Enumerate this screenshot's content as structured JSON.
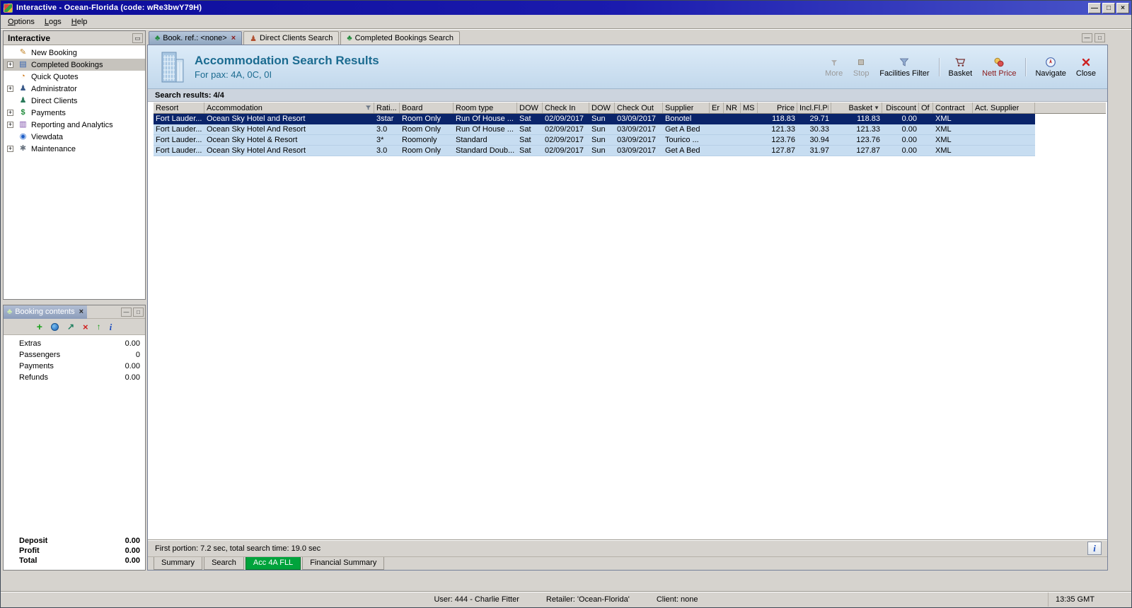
{
  "titlebar": {
    "title": "Interactive - Ocean-Florida (code: wRe3bwY79H)",
    "buttons": {
      "minimize": "—",
      "maximize": "□",
      "close": "×"
    }
  },
  "menubar": {
    "items": [
      "Options",
      "Logs",
      "Help"
    ]
  },
  "sidebar": {
    "title": "Interactive",
    "items": [
      {
        "label": "New Booking",
        "icon": "new-booking-icon",
        "expandable": false,
        "selected": false
      },
      {
        "label": "Completed Bookings",
        "icon": "completed-bookings-icon",
        "expandable": true,
        "selected": true
      },
      {
        "label": "Quick Quotes",
        "icon": "quick-quotes-icon",
        "expandable": false,
        "selected": false
      },
      {
        "label": "Administrator",
        "icon": "administrator-icon",
        "expandable": true,
        "selected": false
      },
      {
        "label": "Direct Clients",
        "icon": "direct-clients-icon",
        "expandable": false,
        "selected": false
      },
      {
        "label": "Payments",
        "icon": "payments-icon",
        "expandable": true,
        "selected": false
      },
      {
        "label": "Reporting and Analytics",
        "icon": "reporting-icon",
        "expandable": true,
        "selected": false
      },
      {
        "label": "Viewdata",
        "icon": "viewdata-icon",
        "expandable": false,
        "selected": false
      },
      {
        "label": "Maintenance",
        "icon": "maintenance-icon",
        "expandable": true,
        "selected": false
      }
    ]
  },
  "booking_contents": {
    "title": "Booking contents",
    "toolbar_icons": [
      "add-icon",
      "world-icon",
      "export-icon",
      "delete-icon",
      "send-icon",
      "info-icon"
    ],
    "rows": [
      {
        "label": "Extras",
        "value": "0.00"
      },
      {
        "label": "Passengers",
        "value": "0"
      },
      {
        "label": "Payments",
        "value": "0.00"
      },
      {
        "label": "Refunds",
        "value": "0.00"
      }
    ],
    "totals": [
      {
        "label": "Deposit",
        "value": "0.00"
      },
      {
        "label": "Profit",
        "value": "0.00"
      },
      {
        "label": "Total",
        "value": "0.00"
      }
    ]
  },
  "tabs": [
    {
      "label": "Book. ref.: <none>",
      "icon": "palm-icon",
      "active": true,
      "closable": true
    },
    {
      "label": "Direct Clients Search",
      "icon": "client-search-icon",
      "active": false,
      "closable": false
    },
    {
      "label": "Completed Bookings Search",
      "icon": "completed-search-icon",
      "active": false,
      "closable": false
    }
  ],
  "header": {
    "title": "Accommodation Search Results",
    "subtitle": "For pax: 4A, 0C, 0I",
    "tools": [
      {
        "label": "More",
        "icon": "more-icon",
        "disabled": true,
        "accent": false,
        "sep_before": false
      },
      {
        "label": "Stop",
        "icon": "stop-icon",
        "disabled": true,
        "accent": false,
        "sep_before": false
      },
      {
        "label": "Facilities Filter",
        "icon": "facilities-filter-icon",
        "disabled": false,
        "accent": false,
        "sep_before": false
      },
      {
        "label": "Basket",
        "icon": "basket-icon",
        "disabled": false,
        "accent": false,
        "sep_before": true
      },
      {
        "label": "Nett Price",
        "icon": "nett-price-icon",
        "disabled": false,
        "accent": true,
        "sep_before": false
      },
      {
        "label": "Navigate",
        "icon": "navigate-icon",
        "disabled": false,
        "accent": false,
        "sep_before": true
      },
      {
        "label": "Close",
        "icon": "close-icon",
        "disabled": false,
        "accent": false,
        "sep_before": false
      }
    ]
  },
  "results": {
    "summary": "Search results: 4/4",
    "columns": [
      "Resort",
      "Accommodation",
      "Rati...",
      "Board",
      "Room type",
      "DOW",
      "Check In",
      "DOW",
      "Check Out",
      "Supplier",
      "Er",
      "NR",
      "MS",
      "Price",
      "Incl.Fl.PP",
      "Basket",
      "Discount",
      "Of",
      "Contract",
      "Act. Supplier"
    ],
    "filter_icon_column": 1,
    "sort_icon_column": 15,
    "selected_row_index": 0,
    "rows": [
      [
        "Fort Lauder...",
        "Ocean Sky Hotel and Resort",
        "3star",
        "Room Only",
        "Run Of House ...",
        "Sat",
        "02/09/2017",
        "Sun",
        "03/09/2017",
        "Bonotel",
        "",
        "",
        "",
        "118.83",
        "29.71",
        "118.83",
        "0.00",
        "",
        "XML",
        ""
      ],
      [
        "Fort Lauder...",
        "Ocean Sky Hotel And Resort",
        "3.0",
        "Room Only",
        "Run Of House ...",
        "Sat",
        "02/09/2017",
        "Sun",
        "03/09/2017",
        "Get A Bed",
        "",
        "",
        "",
        "121.33",
        "30.33",
        "121.33",
        "0.00",
        "",
        "XML",
        ""
      ],
      [
        "Fort Lauder...",
        "Ocean Sky Hotel & Resort",
        "3*",
        "Roomonly",
        "Standard",
        "Sat",
        "02/09/2017",
        "Sun",
        "03/09/2017",
        "Tourico ...",
        "",
        "",
        "",
        "123.76",
        "30.94",
        "123.76",
        "0.00",
        "",
        "XML",
        ""
      ],
      [
        "Fort Lauder...",
        "Ocean Sky Hotel And Resort",
        "3.0",
        "Room Only",
        "Standard Doub...",
        "Sat",
        "02/09/2017",
        "Sun",
        "03/09/2017",
        "Get A Bed",
        "",
        "",
        "",
        "127.87",
        "31.97",
        "127.87",
        "0.00",
        "",
        "XML",
        ""
      ]
    ]
  },
  "footer": {
    "status": "First portion: 7.2 sec, total search time: 19.0 sec",
    "tabs": [
      {
        "label": "Summary",
        "active": false
      },
      {
        "label": "Search",
        "active": false
      },
      {
        "label": "Acc 4A FLL",
        "active": true
      },
      {
        "label": "Financial Summary",
        "active": false
      }
    ]
  },
  "statusbar": {
    "user": "User: 444 - Charlie Fitter",
    "retailer": "Retailer: 'Ocean-Florida'",
    "client": "Client: none",
    "time": "13:35 GMT"
  }
}
